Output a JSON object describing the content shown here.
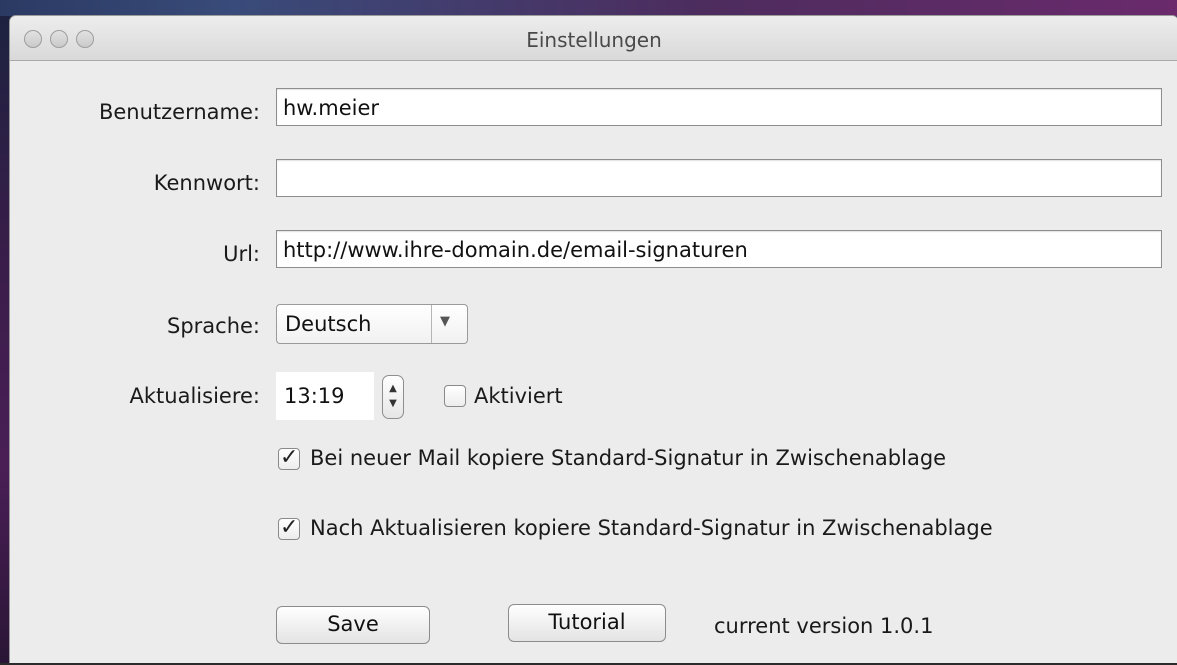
{
  "window": {
    "title": "Einstellungen"
  },
  "form": {
    "username": {
      "label": "Benutzername:",
      "value": "hw.meier"
    },
    "password": {
      "label": "Kennwort:",
      "value": ""
    },
    "url": {
      "label": "Url:",
      "value": "http://www.ihre-domain.de/email-signaturen"
    },
    "language": {
      "label": "Sprache:",
      "selected": "Deutsch"
    },
    "update": {
      "label": "Aktualisiere:",
      "time": "13:19",
      "enabled_label": "Aktiviert",
      "enabled": false
    },
    "copy_on_new_mail": {
      "label": "Bei neuer Mail kopiere Standard-Signatur in Zwischenablage",
      "checked": true
    },
    "copy_after_update": {
      "label": "Nach Aktualisieren kopiere Standard-Signatur in Zwischenablage",
      "checked": true
    }
  },
  "actions": {
    "save_label": "Save",
    "tutorial_label": "Tutorial",
    "version_text": "current version 1.0.1"
  },
  "icons": {
    "traffic_lights": [
      "close-icon",
      "minimize-icon",
      "zoom-icon"
    ],
    "popup_arrow": "chevron-down-icon",
    "stepper": "stepper-icon",
    "check": "checkmark-icon"
  }
}
